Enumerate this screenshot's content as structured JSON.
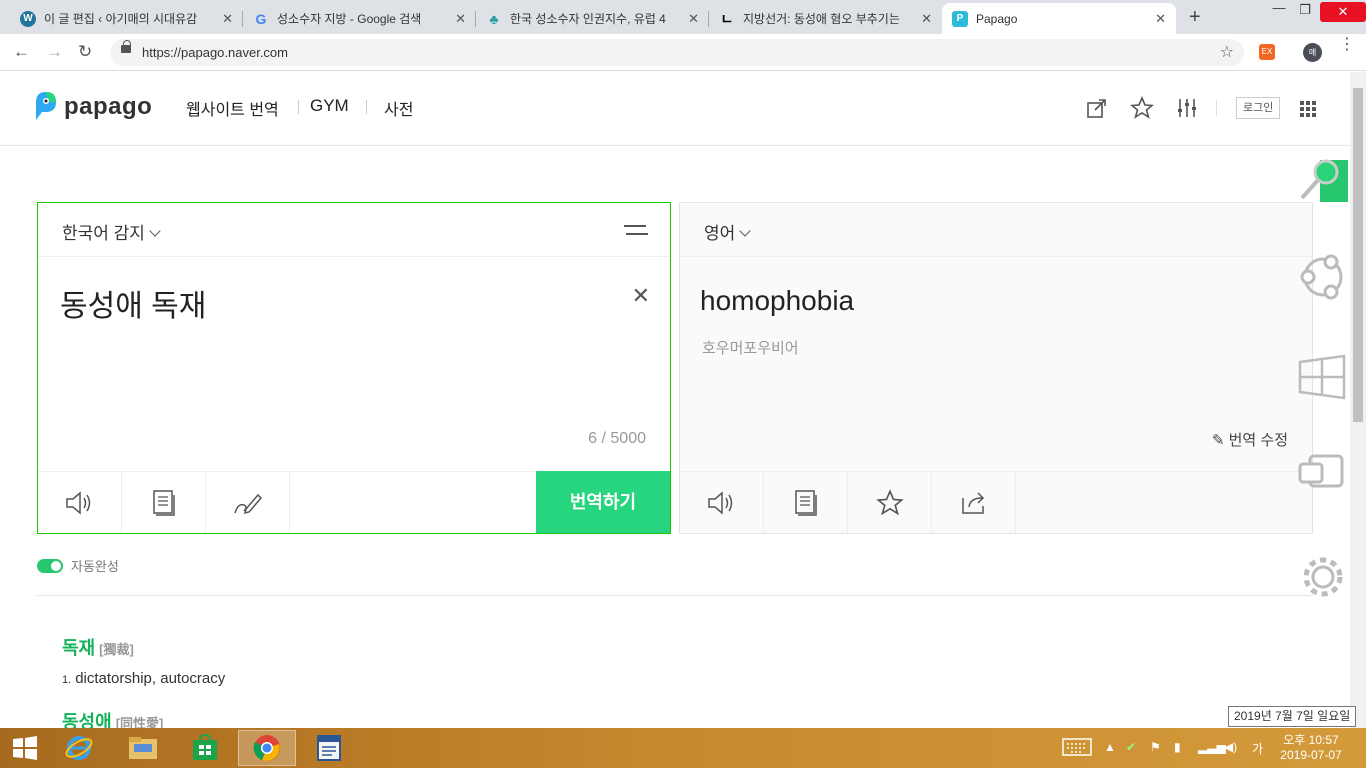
{
  "browser": {
    "tabs": [
      {
        "title": "이 글 편집 ‹ 아기매의 시대유감"
      },
      {
        "title": "성소수자 지방 - Google 검색"
      },
      {
        "title": "한국 성소수자 인권지수, 유럽 4"
      },
      {
        "title": "지방선거: 동성애 혐오 부추기는"
      },
      {
        "title": "Papago"
      }
    ],
    "url": "https://papago.naver.com",
    "profile_initial": "매"
  },
  "header": {
    "logo_text": "papago",
    "nav": [
      "웹사이트 번역",
      "GYM",
      "사전"
    ],
    "login": "로그인"
  },
  "source": {
    "language": "한국어 감지",
    "text": "동성애 독재",
    "counter": "6 / 5000",
    "translate_button": "번역하기"
  },
  "target": {
    "language": "영어",
    "text": "homophobia",
    "pronunciation": "호우머포우비어",
    "edit_label": "번역 수정"
  },
  "autocomplete_label": "자동완성",
  "dictionary": [
    {
      "word": "독재",
      "hanja": "[獨裁]",
      "defs": [
        {
          "num": "1.",
          "text": "dictatorship, autocracy"
        }
      ]
    },
    {
      "word": "동성애",
      "hanja": "[同性愛]"
    }
  ],
  "taskbar": {
    "clock_time": "오후 10:57",
    "clock_date": "2019-07-07",
    "ime": "가",
    "tooltip": "2019년 7월 7일 일요일"
  },
  "colors": {
    "accent": "#1ec800",
    "translate": "#27d57f"
  }
}
